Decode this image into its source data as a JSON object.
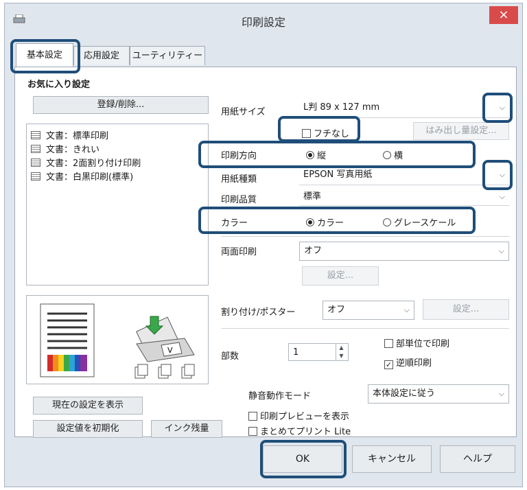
{
  "window": {
    "title": "印刷設定",
    "close_glyph": "×"
  },
  "tabs": [
    {
      "label": "基本設定"
    },
    {
      "label": "応用設定"
    },
    {
      "label": "ユーティリティー"
    }
  ],
  "favorites": {
    "heading": "お気に入り設定",
    "register_button": "登録/削除...",
    "items": [
      "文書：標準印刷",
      "文書：きれい",
      "文書：2面割り付け印刷",
      "文書：白黒印刷(標準)"
    ]
  },
  "left_buttons": {
    "show_current": "現在の設定を表示",
    "reset": "設定値を初期化",
    "ink_levels": "インク残量"
  },
  "settings": {
    "paper_size": {
      "label": "用紙サイズ",
      "value": "L判 89 x 127 mm"
    },
    "borderless": {
      "label": "フチなし",
      "checked": false
    },
    "expansion_button": "はみ出し量設定...",
    "orientation": {
      "label": "印刷方向",
      "options": [
        "縦",
        "横"
      ],
      "selected": "縦"
    },
    "paper_type": {
      "label": "用紙種類",
      "value": "EPSON 写真用紙"
    },
    "quality": {
      "label": "印刷品質",
      "value": "標準"
    },
    "color": {
      "label": "カラー",
      "options": [
        "カラー",
        "グレースケール"
      ],
      "selected": "カラー"
    },
    "duplex": {
      "label": "両面印刷",
      "value": "オフ",
      "settings_button": "設定..."
    },
    "multipage": {
      "label": "割り付け/ポスター",
      "value": "オフ",
      "settings_button": "設定..."
    },
    "copies": {
      "label": "部数",
      "value": "1"
    },
    "collate": {
      "label": "部単位で印刷",
      "checked": false
    },
    "reverse": {
      "label": "逆順印刷",
      "checked": true
    },
    "quiet_mode": {
      "label": "静音動作モード",
      "value": "本体設定に従う"
    },
    "print_preview": {
      "label": "印刷プレビューを表示",
      "checked": false
    },
    "print_lite": {
      "label": "まとめてプリント Lite",
      "checked": false
    }
  },
  "footer": {
    "ok": "OK",
    "cancel": "キャンセル",
    "help": "ヘルプ"
  },
  "colors": {
    "highlight": "#1f4e79",
    "close": "#d94b4b",
    "window_bg": "#dfe6ee"
  },
  "icons": {
    "dropdown": "chevron-down-icon",
    "check_mark": "✓",
    "spin": "spin-arrows-icon"
  }
}
